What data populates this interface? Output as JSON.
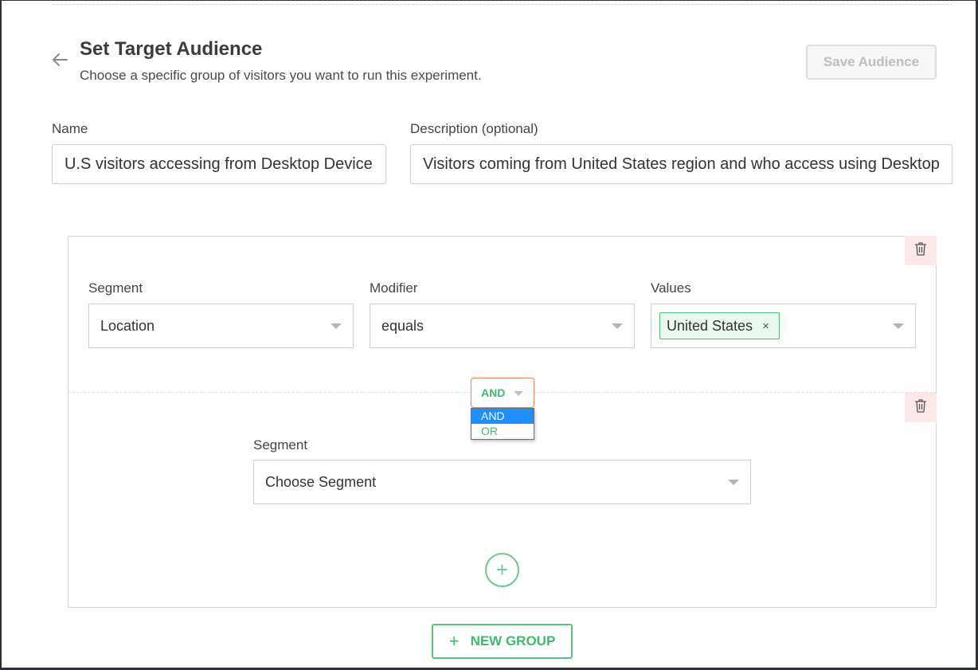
{
  "header": {
    "title": "Set Target Audience",
    "subtitle": "Choose a specific group of visitors you want to run this experiment.",
    "save_label": "Save Audience"
  },
  "form": {
    "name_label": "Name",
    "name_value": "U.S visitors accessing from Desktop Device",
    "description_label": "Description (optional)",
    "description_value": "Visitors coming from United States region and who access using Desktop"
  },
  "group": {
    "condition1": {
      "segment_label": "Segment",
      "segment_value": "Location",
      "modifier_label": "Modifier",
      "modifier_value": "equals",
      "values_label": "Values",
      "tags": [
        "United States"
      ],
      "tag_remove": "×"
    },
    "logic": {
      "value": "AND",
      "options": [
        "AND",
        "OR"
      ]
    },
    "condition2": {
      "segment_label": "Segment",
      "segment_placeholder": "Choose Segment"
    },
    "add_symbol": "+"
  },
  "footer": {
    "new_group_plus": "+",
    "new_group_label": "NEW GROUP"
  },
  "colors": {
    "accent_green": "#3dbb6c",
    "focus_orange": "#f08a5a",
    "option_highlight": "#1f8fff",
    "delete_bg": "#fce8e8"
  },
  "icons": [
    "back-arrow-icon",
    "trash-icon",
    "chevron-down-icon",
    "plus-icon",
    "close-icon"
  ]
}
